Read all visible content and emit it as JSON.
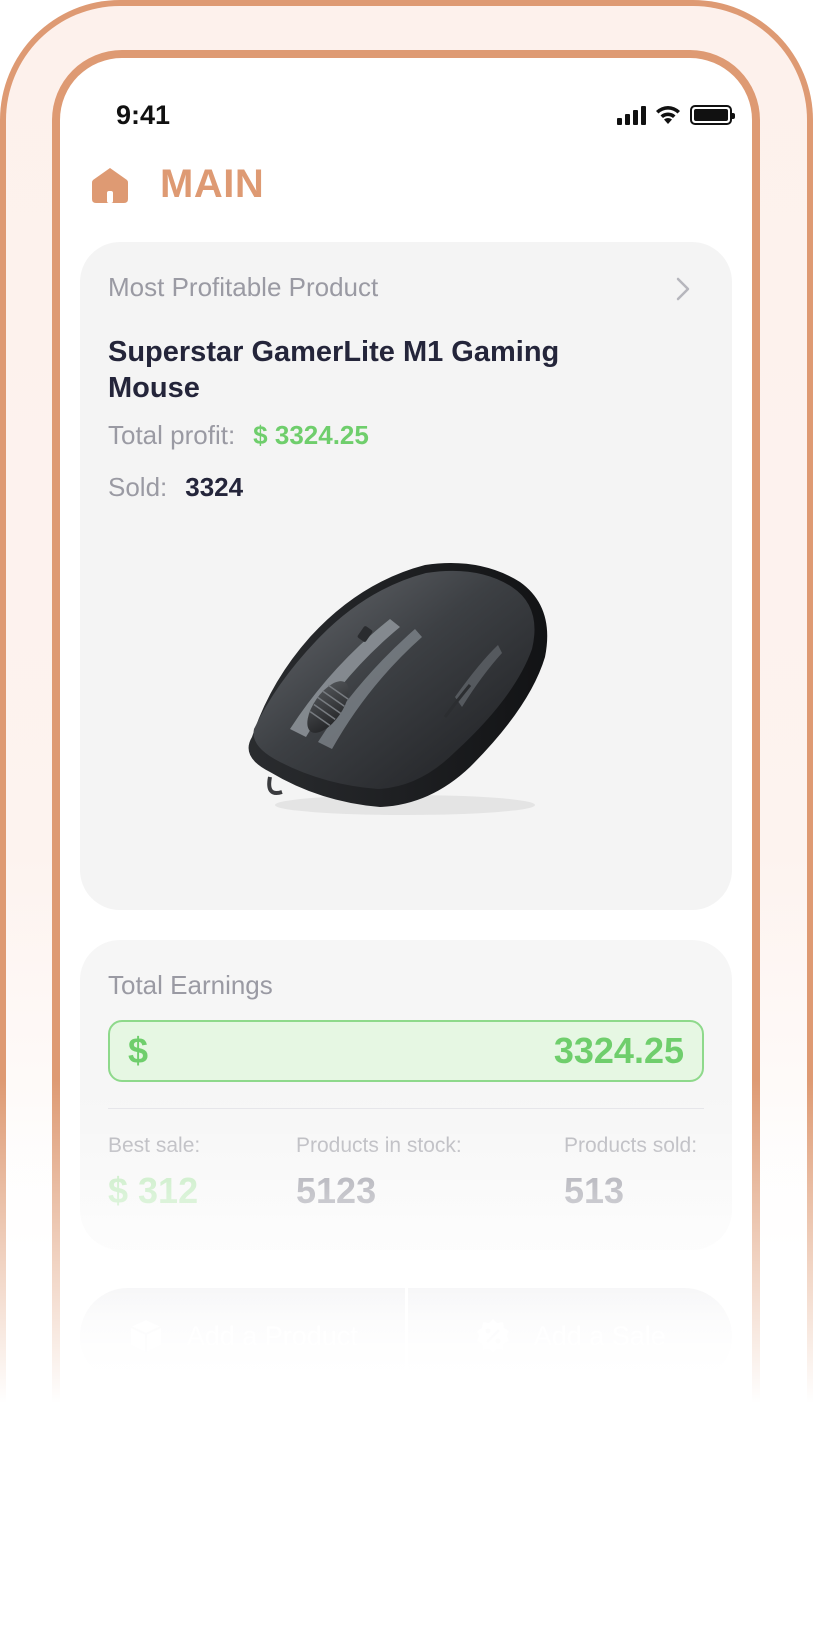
{
  "status_bar": {
    "time": "9:41"
  },
  "header": {
    "title": "MAIN",
    "icon": "home-icon"
  },
  "product_card": {
    "label": "Most Profitable Product",
    "product_name": "Superstar GamerLite M1 Gaming Mouse",
    "profit_label": "Total profit:",
    "profit_value": "$ 3324.25",
    "sold_label": "Sold:",
    "sold_value": "3324",
    "image": "gaming-mouse-image"
  },
  "earnings_card": {
    "label": "Total Earnings",
    "currency": "$",
    "amount": "3324.25",
    "stats": [
      {
        "label": "Best sale:",
        "value": "$ 312"
      },
      {
        "label": "Products in stock:",
        "value": "5123"
      },
      {
        "label": "Products sold:",
        "value": "513"
      }
    ]
  },
  "actions": {
    "add_product": "Add a Product",
    "add_sale": "Add a Sale"
  },
  "colors": {
    "accent": "#de9a73",
    "profit_green": "#6fce6c",
    "text_dark": "#24253a",
    "text_muted": "#9a9aa3"
  }
}
